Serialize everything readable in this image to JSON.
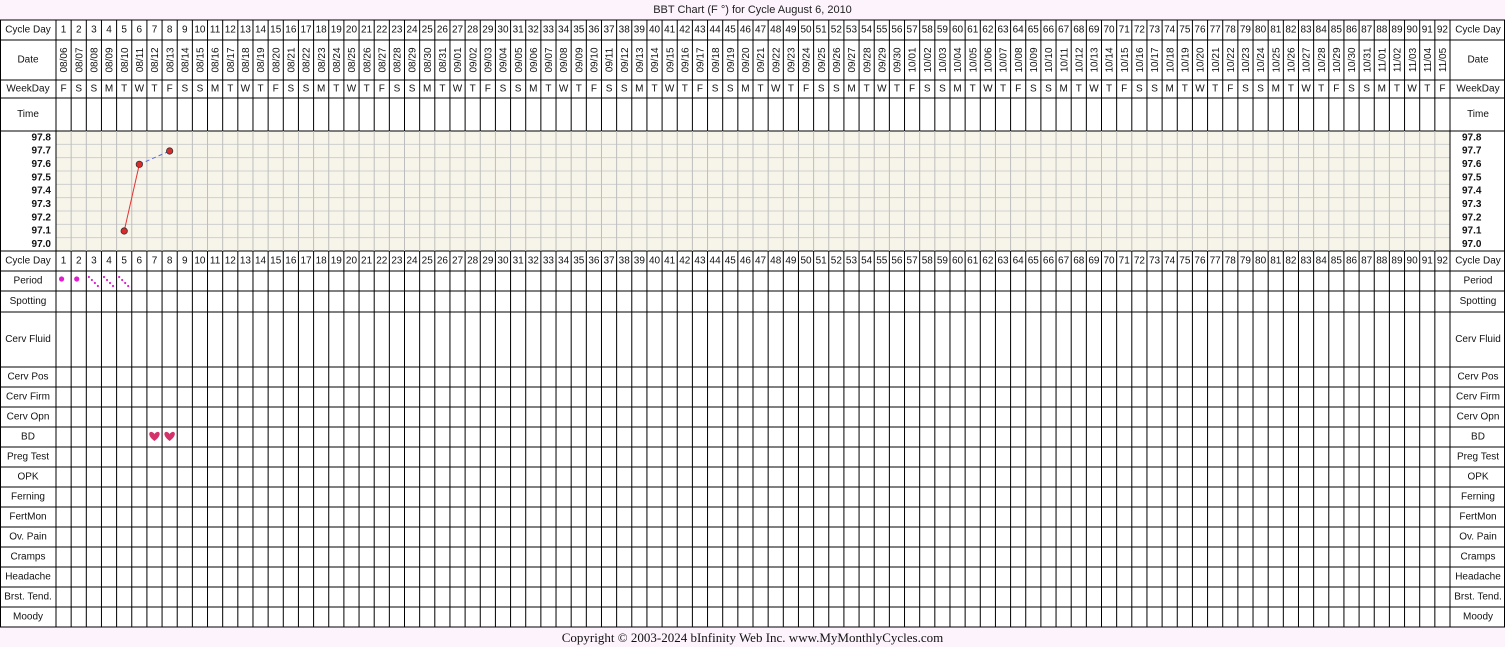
{
  "title": "BBT Chart (F °) for Cycle August 6, 2010",
  "copyright": "Copyright © 2003-2024 bInfinity Web Inc.      www.MyMonthlyCycles.com",
  "row_labels": {
    "cycle_day": "Cycle Day",
    "date": "Date",
    "weekday": "WeekDay",
    "time": "Time",
    "period": "Period",
    "spotting": "Spotting",
    "cerv_fluid": "Cerv Fluid",
    "cerv_pos": "Cerv Pos",
    "cerv_firm": "Cerv Firm",
    "cerv_opn": "Cerv Opn",
    "bd": "BD",
    "preg_test": "Preg Test",
    "opk": "OPK",
    "ferning": "Ferning",
    "fertmon": "FertMon",
    "ov_pain": "Ov. Pain",
    "cramps": "Cramps",
    "headache": "Headache",
    "brst_tend": "Brst. Tend.",
    "moody": "Moody"
  },
  "days": [
    1,
    2,
    3,
    4,
    5,
    6,
    7,
    8,
    9,
    10,
    11,
    12,
    13,
    14,
    15,
    16,
    17,
    18,
    19,
    20,
    21,
    22,
    23,
    24,
    25,
    26,
    27,
    28,
    29,
    30,
    31,
    32,
    33,
    34,
    35,
    36,
    37,
    38,
    39,
    40,
    41,
    42,
    43,
    44,
    45,
    46,
    47,
    48,
    49,
    50,
    51,
    52,
    53,
    54,
    55,
    56,
    57,
    58,
    59,
    60,
    61,
    62,
    63,
    64,
    65,
    66,
    67,
    68,
    69,
    70,
    71,
    72,
    73,
    74,
    75,
    76,
    77,
    78,
    79,
    80,
    81,
    82,
    83,
    84,
    85,
    86,
    87,
    88,
    89,
    90,
    91,
    92
  ],
  "dates": [
    "08/06",
    "08/07",
    "08/08",
    "08/09",
    "08/10",
    "08/11",
    "08/12",
    "08/13",
    "08/14",
    "08/15",
    "08/16",
    "08/17",
    "08/18",
    "08/19",
    "08/20",
    "08/21",
    "08/22",
    "08/23",
    "08/24",
    "08/25",
    "08/26",
    "08/27",
    "08/28",
    "08/29",
    "08/30",
    "08/31",
    "09/01",
    "09/02",
    "09/03",
    "09/04",
    "09/05",
    "09/06",
    "09/07",
    "09/08",
    "09/09",
    "09/10",
    "09/11",
    "09/12",
    "09/13",
    "09/14",
    "09/15",
    "09/16",
    "09/17",
    "09/18",
    "09/19",
    "09/20",
    "09/21",
    "09/22",
    "09/23",
    "09/24",
    "09/25",
    "09/26",
    "09/27",
    "09/28",
    "09/29",
    "09/30",
    "10/01",
    "10/02",
    "10/03",
    "10/04",
    "10/05",
    "10/06",
    "10/07",
    "10/08",
    "10/09",
    "10/10",
    "10/11",
    "10/12",
    "10/13",
    "10/14",
    "10/15",
    "10/16",
    "10/17",
    "10/18",
    "10/19",
    "10/20",
    "10/21",
    "10/22",
    "10/23",
    "10/24",
    "10/25",
    "10/26",
    "10/27",
    "10/28",
    "10/29",
    "10/30",
    "10/31",
    "11/01",
    "11/02",
    "11/03",
    "11/04",
    "11/05"
  ],
  "weekdays": [
    "F",
    "S",
    "S",
    "M",
    "T",
    "W",
    "T",
    "F",
    "S",
    "S",
    "M",
    "T",
    "W",
    "T",
    "F",
    "S",
    "S",
    "M",
    "T",
    "W",
    "T",
    "F",
    "S",
    "S",
    "M",
    "T",
    "W",
    "T",
    "F",
    "S",
    "S",
    "M",
    "T",
    "W",
    "T",
    "F",
    "S",
    "S",
    "M",
    "T",
    "W",
    "T",
    "F",
    "S",
    "S",
    "M",
    "T",
    "W",
    "T",
    "F",
    "S",
    "S",
    "M",
    "T",
    "W",
    "T",
    "F",
    "S",
    "S",
    "M",
    "T",
    "W",
    "T",
    "F",
    "S",
    "S",
    "M",
    "T",
    "W",
    "T",
    "F",
    "S",
    "S",
    "M",
    "T",
    "W",
    "T",
    "F",
    "S",
    "S",
    "M",
    "T",
    "W",
    "T",
    "F",
    "S",
    "S",
    "M",
    "T",
    "W",
    "T",
    "F"
  ],
  "chart_data": {
    "type": "line",
    "title": "BBT Chart (F °) for Cycle August 6, 2010",
    "y_ticks": [
      "97.8",
      "97.7",
      "97.6",
      "97.5",
      "97.4",
      "97.3",
      "97.2",
      "97.1",
      "97.0"
    ],
    "ylim": [
      97.0,
      97.8
    ],
    "temperatures": [
      {
        "day": 5,
        "temp": 97.1
      },
      {
        "day": 6,
        "temp": 97.6
      },
      {
        "day": 8,
        "temp": 97.7
      }
    ],
    "period_days": [
      {
        "day": 1,
        "type": "heavy"
      },
      {
        "day": 2,
        "type": "heavy"
      },
      {
        "day": 3,
        "type": "light"
      },
      {
        "day": 4,
        "type": "light"
      },
      {
        "day": 5,
        "type": "light"
      }
    ],
    "bd_days": [
      7,
      8
    ],
    "colors": {
      "solid_line": "#e33333",
      "gap_line": "#5c6ee0",
      "point": "#d92b2b",
      "period": "#e01ecf",
      "bd": "#d4306a",
      "grid_bg": "#f7f5e9"
    }
  }
}
